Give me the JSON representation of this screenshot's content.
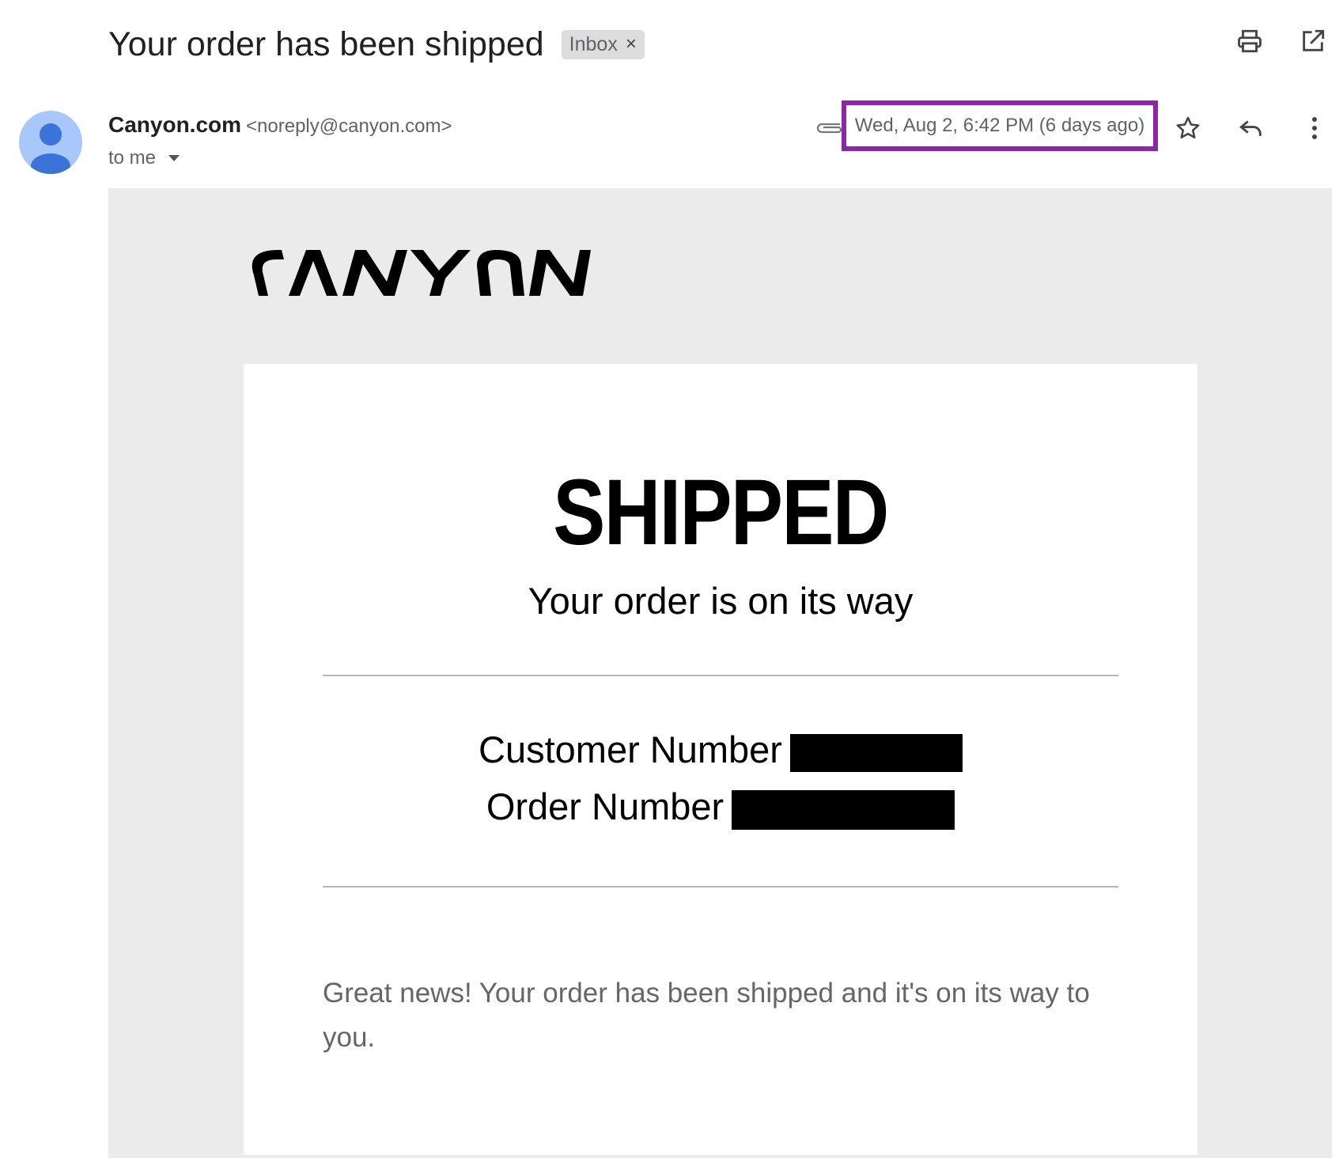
{
  "email": {
    "subject": "Your order has been shipped",
    "label": "Inbox",
    "label_remove": "×",
    "sender_name": "Canyon.com",
    "sender_email": "<noreply@canyon.com>",
    "recipient": "to me",
    "date": "Wed, Aug 2, 6:42 PM (6 days ago)",
    "highlight_color": "#8e24aa"
  },
  "icons": {
    "top_actions": [
      "printer-icon",
      "open-in-new-window-icon"
    ],
    "message_actions": [
      "star-icon",
      "reply-icon",
      "more-vert-icon"
    ],
    "attachment": "paperclip-icon",
    "avatar": "default-person-avatar"
  },
  "body": {
    "logo_text": "CANYON",
    "headline": "SHIPPED",
    "subheadline": "Your order is on its way",
    "customer_number_label": "Customer Number",
    "order_number_label": "Order Number",
    "customer_number_value": "[redacted]",
    "order_number_value": "[redacted]",
    "message": "Great news! Your order has been shipped and it's on its way to you."
  }
}
